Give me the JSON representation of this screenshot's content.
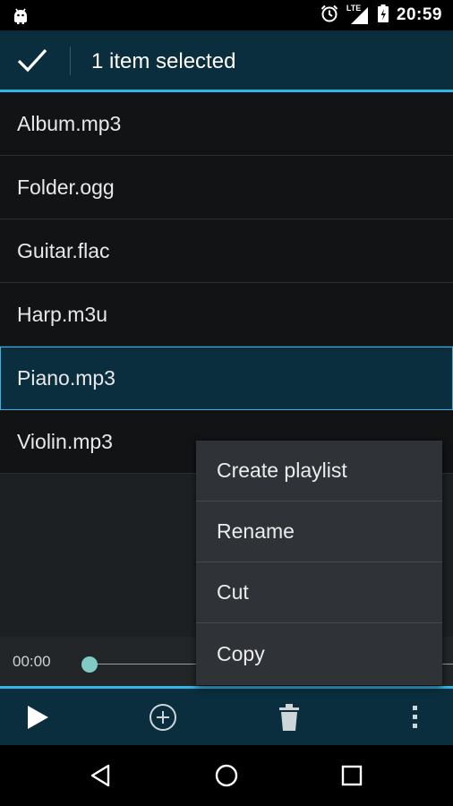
{
  "status_bar": {
    "time": "20:59",
    "network_label": "LTE",
    "icons": [
      "android-icon",
      "alarm-icon",
      "signal-icon",
      "battery-icon"
    ]
  },
  "action_bar": {
    "title": "1 item selected",
    "done_icon": "check-icon"
  },
  "files": [
    {
      "name": "Album.mp3",
      "selected": false
    },
    {
      "name": "Folder.ogg",
      "selected": false
    },
    {
      "name": "Guitar.flac",
      "selected": false
    },
    {
      "name": "Harp.m3u",
      "selected": false
    },
    {
      "name": "Piano.mp3",
      "selected": true
    },
    {
      "name": "Violin.mp3",
      "selected": false
    }
  ],
  "player": {
    "current_time": "00:00",
    "progress": 0
  },
  "toolbar": {
    "icons": [
      "play-icon",
      "add-icon",
      "delete-icon",
      "overflow-menu-icon"
    ]
  },
  "popup_menu": {
    "items": [
      "Create playlist",
      "Rename",
      "Cut",
      "Copy"
    ]
  },
  "navigation": {
    "icons": [
      "back-icon",
      "home-icon",
      "recents-icon"
    ]
  },
  "colors": {
    "accent": "#33b5e5",
    "action_bar_bg": "#0a2e3e",
    "seek_thumb": "#80cbc4"
  }
}
